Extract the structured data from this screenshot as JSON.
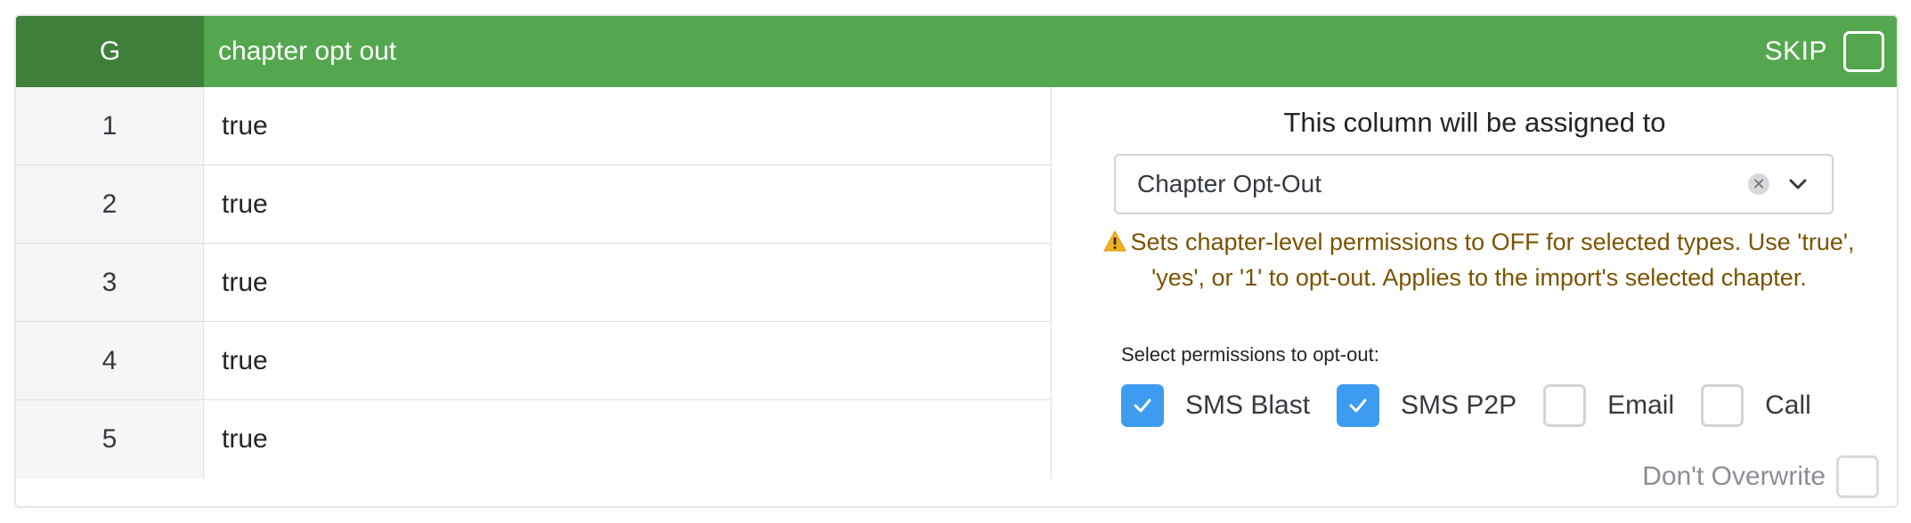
{
  "column": {
    "letter": "G",
    "name": "chapter opt out",
    "skip_label": "SKIP",
    "skip_checked": false
  },
  "rows": [
    {
      "num": "1",
      "value": "true"
    },
    {
      "num": "2",
      "value": "true"
    },
    {
      "num": "3",
      "value": "true"
    },
    {
      "num": "4",
      "value": "true"
    },
    {
      "num": "5",
      "value": "true"
    }
  ],
  "assignment": {
    "title": "This column will be assigned to",
    "selected": "Chapter Opt-Out",
    "clear_icon": "close-icon",
    "dropdown_icon": "chevron-down-icon"
  },
  "warning": {
    "icon": "warning-icon",
    "text": "Sets chapter-level permissions to OFF for selected types. Use 'true', 'yes', or '1' to opt-out. Applies to the import's selected chapter."
  },
  "permissions": {
    "label": "Select permissions to opt-out:",
    "items": [
      {
        "label": "SMS Blast",
        "checked": true
      },
      {
        "label": "SMS P2P",
        "checked": true
      },
      {
        "label": "Email",
        "checked": false
      },
      {
        "label": "Call",
        "checked": false
      }
    ]
  },
  "overwrite": {
    "label": "Don't Overwrite",
    "checked": false
  },
  "colors": {
    "header_green": "#55a74f",
    "header_dark_green": "#3f7f3c",
    "checkbox_blue": "#3d9cf0",
    "warning_text": "#7a5300"
  }
}
